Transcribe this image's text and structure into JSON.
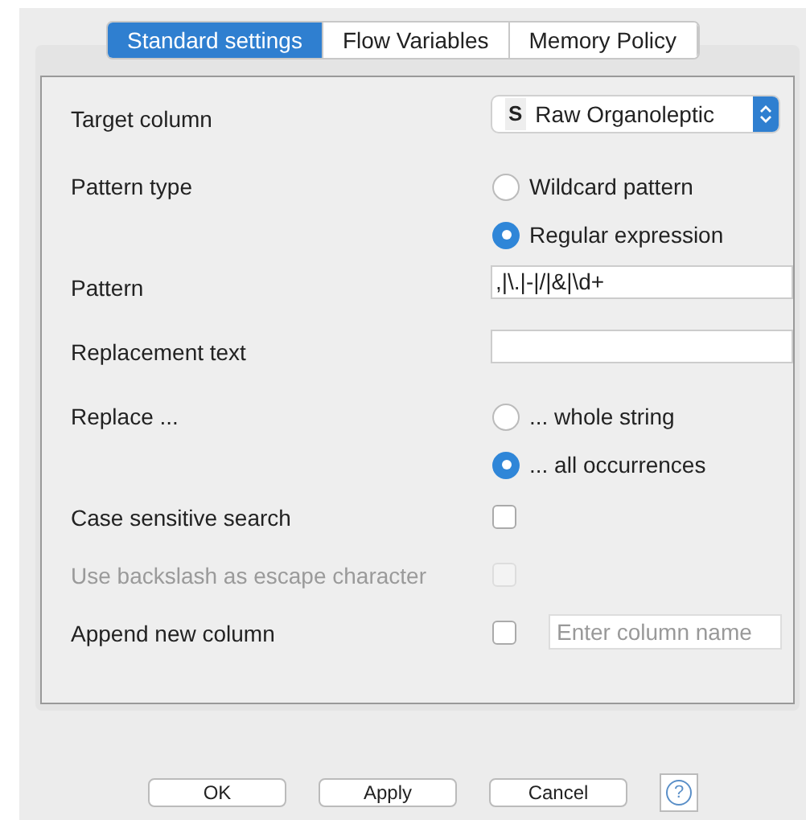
{
  "tabs": [
    {
      "label": "Standard settings",
      "selected": true
    },
    {
      "label": "Flow Variables",
      "selected": false
    },
    {
      "label": "Memory Policy",
      "selected": false
    }
  ],
  "rows": [
    {
      "kind": "select",
      "label": "Target column",
      "type_badge": "S",
      "value": "Raw Organoleptic"
    },
    {
      "kind": "radio",
      "label": "Pattern type",
      "options": [
        {
          "label": "Wildcard pattern",
          "selected": false
        },
        {
          "label": "Regular expression",
          "selected": true
        }
      ]
    },
    {
      "kind": "text",
      "label": "Pattern",
      "value": ",|\\.|-|/|&|\\d+"
    },
    {
      "kind": "text",
      "label": "Replacement text"
    },
    {
      "kind": "radio",
      "label": "Replace ...",
      "options": [
        {
          "label": "... whole string",
          "selected": false
        },
        {
          "label": "... all occurrences",
          "selected": true
        }
      ]
    },
    {
      "kind": "checkbox",
      "label": "Case sensitive search",
      "checked": false,
      "disabled": false
    },
    {
      "kind": "checkbox",
      "label": "Use backslash as escape character",
      "checked": false,
      "disabled": true
    },
    {
      "kind": "checkbox",
      "label": "Append new column",
      "checked": false,
      "disabled": false,
      "placeholder": "Enter column name"
    }
  ],
  "buttons": [
    "OK",
    "Apply",
    "Cancel"
  ],
  "help": "?"
}
